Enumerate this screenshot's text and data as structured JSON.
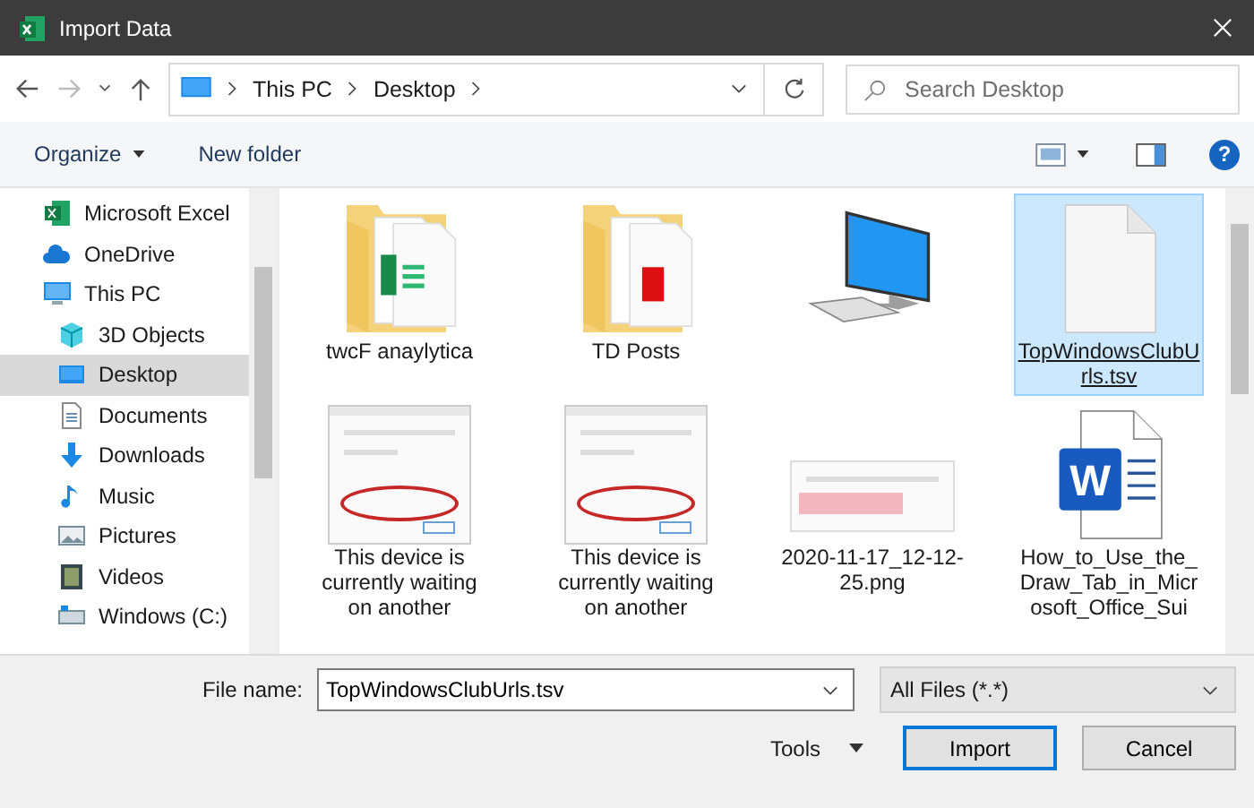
{
  "window": {
    "title": "Import Data"
  },
  "address_bar": {
    "segments": [
      "This PC",
      "Desktop"
    ]
  },
  "search": {
    "placeholder": "Search Desktop"
  },
  "toolbar": {
    "organize": "Organize",
    "new_folder": "New folder",
    "help": "?"
  },
  "sidebar": {
    "items": [
      {
        "label": "Microsoft Excel",
        "selected": false
      },
      {
        "label": "OneDrive",
        "selected": false
      },
      {
        "label": "This PC",
        "selected": false,
        "children": [
          {
            "label": "3D Objects",
            "selected": false
          },
          {
            "label": "Desktop",
            "selected": true
          },
          {
            "label": "Documents",
            "selected": false
          },
          {
            "label": "Downloads",
            "selected": false
          },
          {
            "label": "Music",
            "selected": false
          },
          {
            "label": "Pictures",
            "selected": false
          },
          {
            "label": "Videos",
            "selected": false
          },
          {
            "label": "Windows (C:)",
            "selected": false
          }
        ]
      }
    ]
  },
  "files": [
    {
      "name": "twcF anaylytica",
      "kind": "folder-excel",
      "selected": false
    },
    {
      "name": "TD Posts",
      "kind": "folder-pdf",
      "selected": false
    },
    {
      "kind": "computer",
      "selected": false
    },
    {
      "name": "TopWindowsClubUrls.tsv",
      "kind": "file",
      "selected": true
    },
    {
      "name": "This device is currently waiting on another",
      "kind": "screenshot",
      "selected": false
    },
    {
      "name": "This device is currently waiting on another",
      "kind": "screenshot",
      "selected": false
    },
    {
      "name": "2020-11-17_12-12-25.png",
      "kind": "image",
      "selected": false
    },
    {
      "name": "How_to_Use_the_Draw_Tab_in_Microsoft_Office_Sui",
      "kind": "word",
      "badge": "W",
      "selected": false
    }
  ],
  "file_name": {
    "label": "File name:",
    "value": "TopWindowsClubUrls.tsv"
  },
  "file_type": {
    "value": "All Files (*.*)"
  },
  "buttons": {
    "tools": "Tools",
    "import": "Import",
    "cancel": "Cancel"
  }
}
